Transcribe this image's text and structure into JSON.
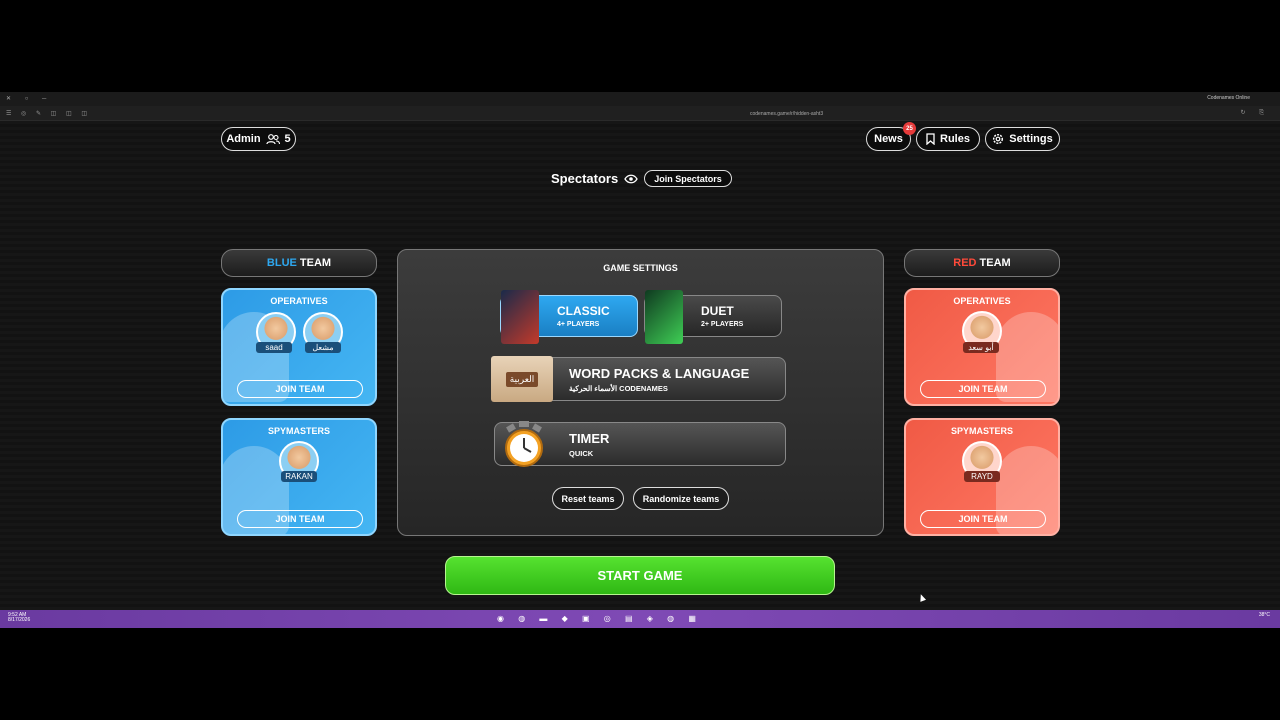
{
  "browser": {
    "tab_title": "Codenames Online",
    "url": "codenames.game/r/hidden-asht3"
  },
  "header": {
    "admin_label": "Admin",
    "player_count": "5",
    "news_label": "News",
    "news_badge": "25",
    "rules_label": "Rules",
    "settings_label": "Settings"
  },
  "spectators": {
    "title": "Spectators",
    "join_label": "Join Spectators"
  },
  "blue_team": {
    "title_color_word": "BLUE",
    "title_rest": " TEAM",
    "operatives": {
      "title": "OPERATIVES",
      "players": [
        "saad",
        "مشعل"
      ],
      "join_label": "JOIN TEAM"
    },
    "spymasters": {
      "title": "SPYMASTERS",
      "players": [
        "RAKAN"
      ],
      "join_label": "JOIN TEAM"
    }
  },
  "red_team": {
    "title_color_word": "RED",
    "title_rest": " TEAM",
    "operatives": {
      "title": "OPERATIVES",
      "players": [
        "أبو سعد"
      ],
      "join_label": "JOIN TEAM"
    },
    "spymasters": {
      "title": "SPYMASTERS",
      "players": [
        "RAYD"
      ],
      "join_label": "JOIN TEAM"
    }
  },
  "game_settings": {
    "title": "GAME SETTINGS",
    "modes": [
      {
        "name": "CLASSIC",
        "players": "4+ PLAYERS",
        "selected": true
      },
      {
        "name": "DUET",
        "players": "2+ PLAYERS",
        "selected": false
      }
    ],
    "word_packs": {
      "title": "WORD PACKS & LANGUAGE",
      "value": "الأسماء الحركية CODENAMES",
      "box_text": "العربية"
    },
    "timer": {
      "title": "TIMER",
      "value": "QUICK"
    },
    "reset_label": "Reset teams",
    "randomize_label": "Randomize teams"
  },
  "start_label": "START GAME",
  "taskbar": {
    "time": "9:52 AM",
    "date": "8/17/2026",
    "weather": "38°C"
  },
  "colors": {
    "blue": "#2ea8f0",
    "red": "#ff4a3a",
    "green": "#3fcf22"
  }
}
